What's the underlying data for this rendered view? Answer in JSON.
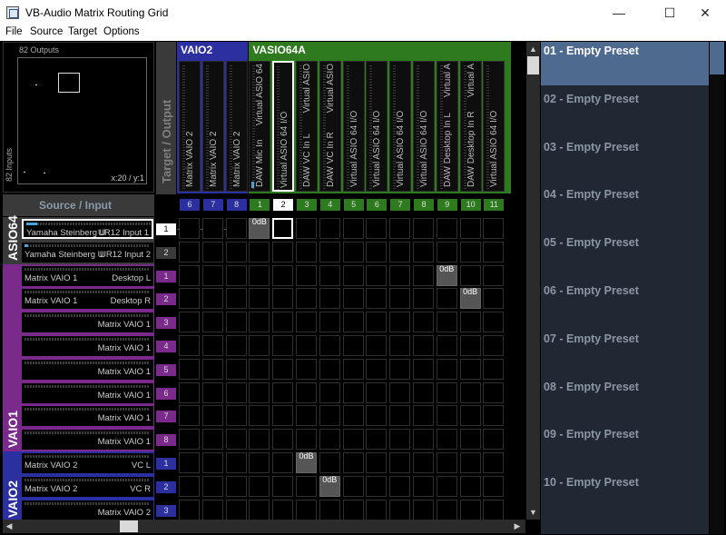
{
  "window": {
    "title": "VB-Audio Matrix Routing Grid",
    "minimize": "—",
    "maximize": "☐",
    "close": "✕"
  },
  "menu": [
    "File",
    "Source",
    "Target",
    "Options"
  ],
  "overview": {
    "outputs_label": "82 Outputs",
    "inputs_label": "82 Inputs",
    "position": "x:20 / y:1"
  },
  "headers": {
    "target": "Target / Output",
    "source": "Source / Input"
  },
  "output_groups": [
    {
      "name": "VAIO2",
      "color": "#2b2fa0"
    },
    {
      "name": "VASIO64A",
      "color": "#2e7a1e"
    }
  ],
  "outputs": [
    {
      "num": "6",
      "left": "Matrix VAIO 2",
      "right": ""
    },
    {
      "num": "7",
      "left": "Matrix VAIO 2",
      "right": ""
    },
    {
      "num": "8",
      "left": "Matrix VAIO 2",
      "right": ""
    },
    {
      "num": "1",
      "left": "DAW Mic In",
      "right": "Virtual ASIO 64"
    },
    {
      "num": "2",
      "left": "Virtual ASIO 64 I/O",
      "right": ""
    },
    {
      "num": "3",
      "left": "DAW VC In L",
      "right": "Virtual ASIO"
    },
    {
      "num": "4",
      "left": "DAW VC In R",
      "right": "Virtual ASIO"
    },
    {
      "num": "5",
      "left": "Virtual ASIO 64 I/O",
      "right": ""
    },
    {
      "num": "6",
      "left": "Virtual ASIO 64 I/O",
      "right": ""
    },
    {
      "num": "7",
      "left": "Virtual ASIO 64 I/O",
      "right": ""
    },
    {
      "num": "8",
      "left": "Virtual ASIO 64 I/O",
      "right": ""
    },
    {
      "num": "9",
      "left": "DAW Desktop In L",
      "right": "Virtual A"
    },
    {
      "num": "10",
      "left": "DAW Desktop In R",
      "right": "Virtual A"
    },
    {
      "num": "11",
      "left": "Virtual ASIO 64 I/O",
      "right": ""
    }
  ],
  "input_groups": [
    {
      "name": "ASIO64",
      "color": "#3a3a3a"
    },
    {
      "name": "VAIO1",
      "color": "#7a2a8a"
    },
    {
      "name": "VAIO2",
      "color": "#2b2fa0"
    }
  ],
  "inputs": [
    {
      "num": "1",
      "left": "Yamaha Steinberg U",
      "right": "UR12 Input 1"
    },
    {
      "num": "2",
      "left": "Yamaha Steinberg U",
      "right": "UR12 Input 2"
    },
    {
      "num": "1",
      "left": "Matrix VAIO 1",
      "right": "Desktop L"
    },
    {
      "num": "2",
      "left": "Matrix VAIO 1",
      "right": "Desktop R"
    },
    {
      "num": "3",
      "left": "",
      "right": "Matrix VAIO 1"
    },
    {
      "num": "4",
      "left": "",
      "right": "Matrix VAIO 1"
    },
    {
      "num": "5",
      "left": "",
      "right": "Matrix VAIO 1"
    },
    {
      "num": "6",
      "left": "",
      "right": "Matrix VAIO 1"
    },
    {
      "num": "7",
      "left": "",
      "right": "Matrix VAIO 1"
    },
    {
      "num": "8",
      "left": "",
      "right": "Matrix VAIO 1"
    },
    {
      "num": "1",
      "left": "Matrix VAIO 2",
      "right": "VC L"
    },
    {
      "num": "2",
      "left": "Matrix VAIO 2",
      "right": "VC R"
    },
    {
      "num": "3",
      "left": "",
      "right": "Matrix VAIO 2"
    }
  ],
  "routes": [
    {
      "row": 0,
      "col": 3,
      "label": "0dB"
    },
    {
      "row": 2,
      "col": 11,
      "label": "0dB"
    },
    {
      "row": 3,
      "col": 12,
      "label": "0dB"
    },
    {
      "row": 10,
      "col": 5,
      "label": "0dB"
    },
    {
      "row": 11,
      "col": 6,
      "label": "0dB"
    }
  ],
  "dash_marks": "-",
  "presets": [
    "01 - Empty Preset",
    "02 - Empty Preset",
    "03 - Empty Preset",
    "04 - Empty Preset",
    "05 - Empty Preset",
    "06 - Empty Preset",
    "07 - Empty Preset",
    "08 - Empty Preset",
    "09 - Empty Preset",
    "10 - Empty Preset"
  ],
  "scroll": {
    "left": "◀",
    "right": "▶",
    "up": "▲",
    "down": "▼"
  }
}
